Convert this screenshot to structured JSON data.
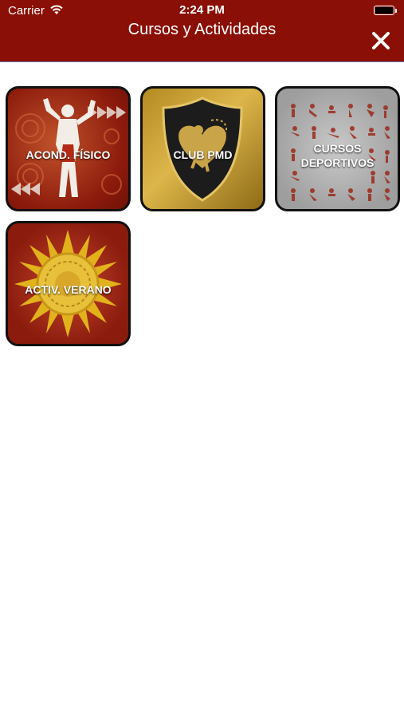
{
  "status_bar": {
    "carrier": "Carrier",
    "time": "2:24 PM",
    "icons": [
      "wifi-icon",
      "battery-icon"
    ]
  },
  "header": {
    "title": "Cursos y Actividades",
    "close_icon": "close-icon",
    "background_color": "#8a0f06"
  },
  "tiles": [
    {
      "label": "ACOND. FÍSICO",
      "icon": "fitness-athlete-icon"
    },
    {
      "label": "CLUB PMD",
      "icon": "club-shield-icon"
    },
    {
      "label_line1": "CURSOS",
      "label_line2": "DEPORTIVOS",
      "icon": "sports-pictograms-icon"
    },
    {
      "label": "ACTIV. VERANO",
      "icon": "sun-icon"
    }
  ]
}
